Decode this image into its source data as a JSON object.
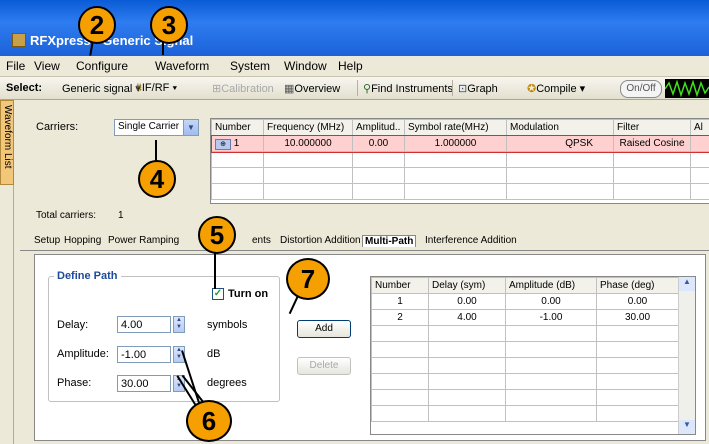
{
  "title": "RFXpress - Generic Signal",
  "menu": [
    "File",
    "View",
    "Configure",
    "Waveform",
    "System",
    "Window",
    "Help"
  ],
  "toolbar": {
    "select_label": "Select:",
    "generic_signal": "Generic signal",
    "if_rf": "IF/RF",
    "calibration": "Calibration",
    "overview": "Overview",
    "find_instruments": "Find Instruments",
    "graph": "Graph",
    "compile": "Compile",
    "onoff": "On/Off"
  },
  "left_tab": "Waveform List",
  "carriers": {
    "label": "Carriers:",
    "value": "Single Carrier",
    "total_label": "Total carriers:",
    "total_value": "1"
  },
  "carrier_table": {
    "headers": [
      "Number",
      "Frequency (MHz)",
      "Amplitud..",
      "Symbol rate(MHz)",
      "Modulation",
      "Filter",
      "Al"
    ],
    "rows": [
      [
        "1",
        "10.000000",
        "0.00",
        "1.000000",
        "QPSK",
        "Raised Cosine",
        ""
      ]
    ]
  },
  "tabs": [
    "Setup",
    "Hopping",
    "Power Ramping",
    "",
    "ents",
    "Distortion Addition",
    "Multi-Path",
    "Interference Addition"
  ],
  "define_path": {
    "title": "Define Path",
    "turn_on": "Turn on",
    "turn_on_checked": true,
    "delay_label": "Delay:",
    "delay_value": "4.00",
    "delay_unit": "symbols",
    "amplitude_label": "Amplitude:",
    "amplitude_value": "-1.00",
    "amplitude_unit": "dB",
    "phase_label": "Phase:",
    "phase_value": "30.00",
    "phase_unit": "degrees"
  },
  "buttons": {
    "add": "Add",
    "delete": "Delete"
  },
  "path_table": {
    "headers": [
      "Number",
      "Delay (sym)",
      "Amplitude (dB)",
      "Phase (deg)"
    ],
    "rows": [
      [
        "1",
        "0.00",
        "0.00",
        "0.00"
      ],
      [
        "2",
        "4.00",
        "-1.00",
        "30.00"
      ]
    ]
  },
  "callouts": {
    "c2": "2",
    "c3": "3",
    "c4": "4",
    "c5": "5",
    "c6": "6",
    "c7": "7"
  },
  "colors": {
    "callout": "#f5a000",
    "titlebar": "#1b62d8",
    "window": "#ece9d8"
  }
}
